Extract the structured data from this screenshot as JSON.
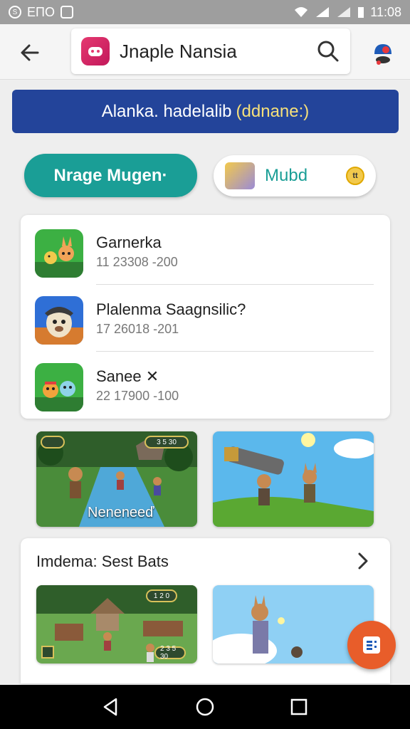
{
  "status_bar": {
    "left_text": "ЕПО",
    "time": "11:08"
  },
  "search": {
    "query": "Jnaple Nansia"
  },
  "banner": {
    "text": "Alanka. hadelalib",
    "paren": "(ddnane:)"
  },
  "chips": {
    "primary_label": "Nrage Mugen·",
    "secondary_label": "Mubd",
    "secondary_badge": "tt"
  },
  "games": [
    {
      "title": "Garnerka",
      "meta": "11 23308 -200"
    },
    {
      "title": "Plalenma Saagnsilic?",
      "meta": "17 26018 -201"
    },
    {
      "title": "Sanee ✕",
      "meta": "22 17900 -100"
    }
  ],
  "tiles": {
    "first_caption": "Neneneeď",
    "hud_1": "3 5 30",
    "hud_2": "1 2 0",
    "hud_3": "2 3 5 30",
    "hud_4": "2 28 30"
  },
  "section": {
    "title": "Imdema: Sest Bats"
  },
  "colors": {
    "accent_teal": "#1a9e96",
    "banner_blue": "#23449a",
    "fab_orange": "#e85d2a"
  }
}
